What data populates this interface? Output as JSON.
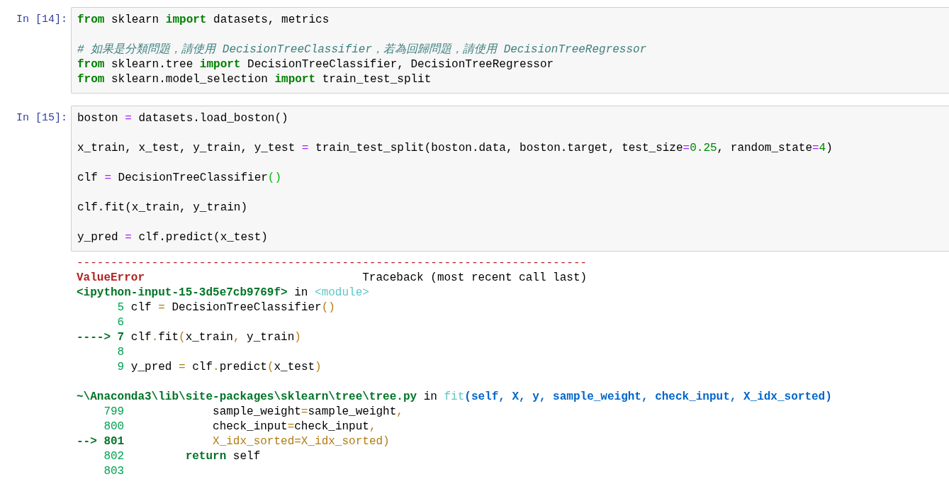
{
  "cells": [
    {
      "prompt": "In [14]:",
      "lines": [
        {
          "kind": "code",
          "tokens": [
            {
              "t": "from",
              "kind": "kw"
            },
            {
              "t": " sklearn ",
              "kind": "plain"
            },
            {
              "t": "import",
              "kind": "kw"
            },
            {
              "t": " datasets, metrics",
              "kind": "plain"
            }
          ]
        },
        {
          "kind": "blank"
        },
        {
          "kind": "code",
          "tokens": [
            {
              "t": "# 如果是分類問題，請使用 DecisionTreeClassifier，若為回歸問題，請使用 DecisionTreeRegressor",
              "kind": "comment"
            }
          ]
        },
        {
          "kind": "code",
          "tokens": [
            {
              "t": "from",
              "kind": "kw"
            },
            {
              "t": " sklearn.tree ",
              "kind": "plain"
            },
            {
              "t": "import",
              "kind": "kw"
            },
            {
              "t": " DecisionTreeClassifier, DecisionTreeRegressor",
              "kind": "plain"
            }
          ]
        },
        {
          "kind": "code",
          "tokens": [
            {
              "t": "from",
              "kind": "kw"
            },
            {
              "t": " sklearn.model_selection ",
              "kind": "plain"
            },
            {
              "t": "import",
              "kind": "kw"
            },
            {
              "t": " train_test_split",
              "kind": "plain"
            }
          ]
        }
      ]
    },
    {
      "prompt": "In [15]:",
      "lines": [
        {
          "kind": "code",
          "tokens": [
            {
              "t": "boston ",
              "kind": "plain"
            },
            {
              "t": "=",
              "kind": "op"
            },
            {
              "t": " datasets.load_boston()",
              "kind": "plain"
            }
          ]
        },
        {
          "kind": "blank"
        },
        {
          "kind": "code",
          "tokens": [
            {
              "t": "x_train, x_test, y_train, y_test ",
              "kind": "plain"
            },
            {
              "t": "=",
              "kind": "op"
            },
            {
              "t": " train_test_split(boston.data, boston.target, test_size",
              "kind": "plain"
            },
            {
              "t": "=",
              "kind": "op"
            },
            {
              "t": "0.25",
              "kind": "num"
            },
            {
              "t": ", random_state",
              "kind": "plain"
            },
            {
              "t": "=",
              "kind": "op"
            },
            {
              "t": "4",
              "kind": "num"
            },
            {
              "t": ")",
              "kind": "plain"
            }
          ]
        },
        {
          "kind": "blank"
        },
        {
          "kind": "code",
          "tokens": [
            {
              "t": "clf ",
              "kind": "plain"
            },
            {
              "t": "=",
              "kind": "op"
            },
            {
              "t": " DecisionTreeClassifier",
              "kind": "plain"
            },
            {
              "t": "()",
              "kind": "bracket"
            }
          ]
        },
        {
          "kind": "blank"
        },
        {
          "kind": "code",
          "tokens": [
            {
              "t": "clf.fit(x_train, y_train)",
              "kind": "plain"
            }
          ]
        },
        {
          "kind": "blank"
        },
        {
          "kind": "code",
          "tokens": [
            {
              "t": "y_pred ",
              "kind": "plain"
            },
            {
              "t": "=",
              "kind": "op"
            },
            {
              "t": " clf.predict(x_test)",
              "kind": "plain"
            }
          ]
        }
      ]
    }
  ],
  "output": [
    {
      "kind": "code",
      "tokens": [
        {
          "t": "---------------------------------------------------------------------------",
          "kind": "red"
        }
      ]
    },
    {
      "kind": "code",
      "tokens": [
        {
          "t": "ValueError",
          "kind": "ename"
        },
        {
          "t": "                                Traceback (most recent call last)",
          "kind": "plain"
        }
      ]
    },
    {
      "kind": "code",
      "tokens": [
        {
          "t": "<ipython-input-15-3d5e7cb9769f>",
          "kind": "green"
        },
        {
          "t": " in ",
          "kind": "plain"
        },
        {
          "t": "<module>",
          "kind": "cyan"
        }
      ]
    },
    {
      "kind": "code",
      "tokens": [
        {
          "t": "      5",
          "kind": "lineno"
        },
        {
          "t": " clf ",
          "kind": "plain"
        },
        {
          "t": "=",
          "kind": "yellow"
        },
        {
          "t": " DecisionTreeClassifier",
          "kind": "plain"
        },
        {
          "t": "()",
          "kind": "yellow"
        }
      ]
    },
    {
      "kind": "code",
      "tokens": [
        {
          "t": "      6",
          "kind": "lineno"
        }
      ]
    },
    {
      "kind": "code",
      "tokens": [
        {
          "t": "----> 7",
          "kind": "green"
        },
        {
          "t": " clf",
          "kind": "plain"
        },
        {
          "t": ".",
          "kind": "yellow"
        },
        {
          "t": "fit",
          "kind": "plain"
        },
        {
          "t": "(",
          "kind": "yellow"
        },
        {
          "t": "x_train",
          "kind": "plain"
        },
        {
          "t": ",",
          "kind": "yellow"
        },
        {
          "t": " y_train",
          "kind": "plain"
        },
        {
          "t": ")",
          "kind": "yellow"
        }
      ]
    },
    {
      "kind": "code",
      "tokens": [
        {
          "t": "      8",
          "kind": "lineno"
        }
      ]
    },
    {
      "kind": "code",
      "tokens": [
        {
          "t": "      9",
          "kind": "lineno"
        },
        {
          "t": " y_pred ",
          "kind": "plain"
        },
        {
          "t": "=",
          "kind": "yellow"
        },
        {
          "t": " clf",
          "kind": "plain"
        },
        {
          "t": ".",
          "kind": "yellow"
        },
        {
          "t": "predict",
          "kind": "plain"
        },
        {
          "t": "(",
          "kind": "yellow"
        },
        {
          "t": "x_test",
          "kind": "plain"
        },
        {
          "t": ")",
          "kind": "yellow"
        }
      ]
    },
    {
      "kind": "blank"
    },
    {
      "kind": "code",
      "tokens": [
        {
          "t": "~\\Anaconda3\\lib\\site-packages\\sklearn\\tree\\tree.py",
          "kind": "green"
        },
        {
          "t": " in ",
          "kind": "plain"
        },
        {
          "t": "fit",
          "kind": "cyan"
        },
        {
          "t": "(self, X, y, sample_weight, check_input, X_idx_sorted)",
          "kind": "blue"
        }
      ]
    },
    {
      "kind": "code",
      "tokens": [
        {
          "t": "    799",
          "kind": "lineno"
        },
        {
          "t": "             sample_weight",
          "kind": "plain"
        },
        {
          "t": "=",
          "kind": "yellow"
        },
        {
          "t": "sample_weight",
          "kind": "plain"
        },
        {
          "t": ",",
          "kind": "yellow"
        }
      ]
    },
    {
      "kind": "code",
      "tokens": [
        {
          "t": "    800",
          "kind": "lineno"
        },
        {
          "t": "             check_input",
          "kind": "plain"
        },
        {
          "t": "=",
          "kind": "yellow"
        },
        {
          "t": "check_input",
          "kind": "plain"
        },
        {
          "t": ",",
          "kind": "yellow"
        }
      ]
    },
    {
      "kind": "code",
      "tokens": [
        {
          "t": "--> 801",
          "kind": "green"
        },
        {
          "t": "             X_idx_sorted=X_idx_sorted)",
          "kind": "yellow"
        }
      ]
    },
    {
      "kind": "code",
      "tokens": [
        {
          "t": "    802",
          "kind": "lineno"
        },
        {
          "t": "         return",
          "kind": "green"
        },
        {
          "t": " self",
          "kind": "plain"
        }
      ]
    },
    {
      "kind": "code",
      "tokens": [
        {
          "t": "    803",
          "kind": "lineno"
        }
      ]
    }
  ]
}
